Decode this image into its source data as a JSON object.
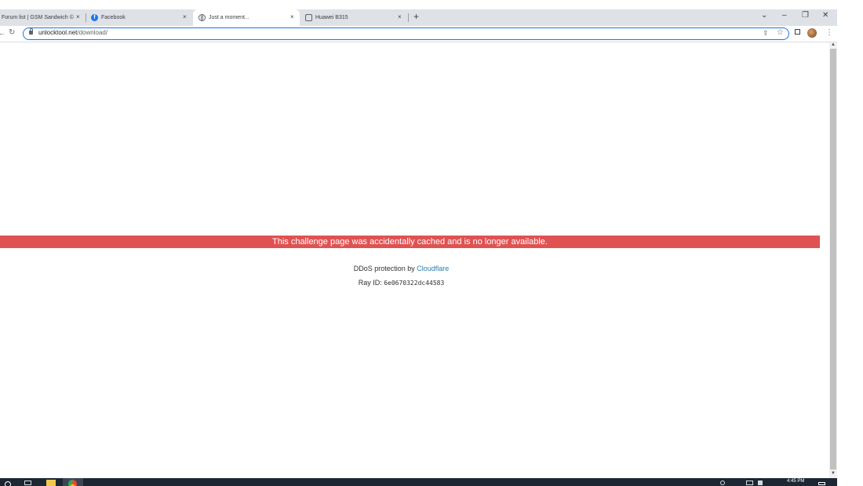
{
  "browser": {
    "tabs": [
      {
        "label": "Forum list | GSM Sandwich ©",
        "icon": "none"
      },
      {
        "label": "Facebook",
        "icon": "facebook-icon"
      },
      {
        "label": "Just a moment...",
        "icon": "globe-icon",
        "active": true
      },
      {
        "label": "Huawei B315",
        "icon": "router-icon"
      }
    ],
    "close_glyph": "×",
    "new_tab_glyph": "+",
    "url_host": "unlocktool.net",
    "url_path": "/download/",
    "window": {
      "minimize": "–",
      "restore": "❐",
      "close": "✕",
      "tab_search": "⌄"
    }
  },
  "page": {
    "banner": "This challenge page was accidentally cached and is no longer available.",
    "ddos_prefix": "DDoS protection by ",
    "ddos_link": "Cloudflare",
    "ray_prefix": "Ray ID: ",
    "ray_id": "6e0670322dc44583"
  },
  "taskbar": {
    "time": "4:45 PM"
  },
  "colors": {
    "banner_bg": "#e05252",
    "link": "#2c7cb0",
    "omnibox_border": "#1a73e8"
  }
}
